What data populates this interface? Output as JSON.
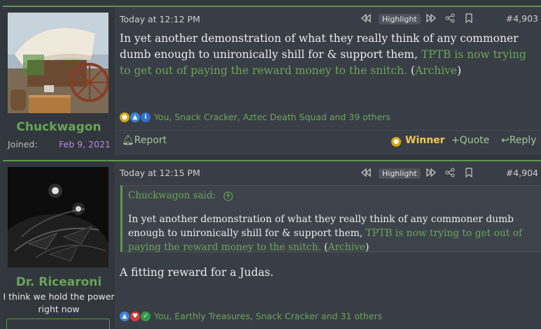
{
  "post1": {
    "username": "Chuckwagon",
    "joined_label": "Joined:",
    "joined_value": "Feb 9, 2021",
    "date": "Today at 12:12 PM",
    "highlight_label": "Highlight",
    "post_number": "#4,903",
    "body_part1": "In yet another demonstration of what they really think of any commoner dumb enough to unironically shill for & support them, ",
    "body_link": "TPTB is now trying to get out of paying the reward money to the snitch.",
    "body_paren_open": " (",
    "body_archive": "Archive",
    "body_paren_close": ")",
    "reactions_text": "You, Snack Cracker, Aztec Death Squad and 39 others",
    "report_label": "Report",
    "winner_label": "Winner",
    "quote_label": "Quote",
    "reply_label": "Reply"
  },
  "post2": {
    "username": "Dr. Ricearoni",
    "user_title": "I think we hold the power right now",
    "date": "Today at 12:15 PM",
    "highlight_label": "Highlight",
    "post_number": "#4,904",
    "quote_said": "Chuckwagon said:",
    "quote_part1": "In yet another demonstration of what they really think of any commoner dumb enough to unironically shill for & support them, ",
    "quote_link": "TPTB is now trying to get out of paying the reward money to the snitch.",
    "quote_paren_open": " (",
    "quote_archive": "Archive",
    "quote_paren_close": ")",
    "body": "A fitting reward for a Judas.",
    "reactions_text": "You, Earthly Treasures, Snack Cracker and 31 others"
  },
  "icons": [
    "rewind-icon",
    "forward-icon",
    "share-icon",
    "bookmark-icon",
    "bell-icon",
    "medal-icon",
    "plus-icon",
    "reply-icon",
    "arrow-up-circle-icon",
    "thumbs-up-icon",
    "info-icon",
    "heart-icon",
    "check-icon"
  ],
  "colors": {
    "accent_green": "#6aa65a",
    "border_green": "#5c9a4a",
    "joined_date": "#b58ae0",
    "winner_gold": "#f2c94c"
  }
}
